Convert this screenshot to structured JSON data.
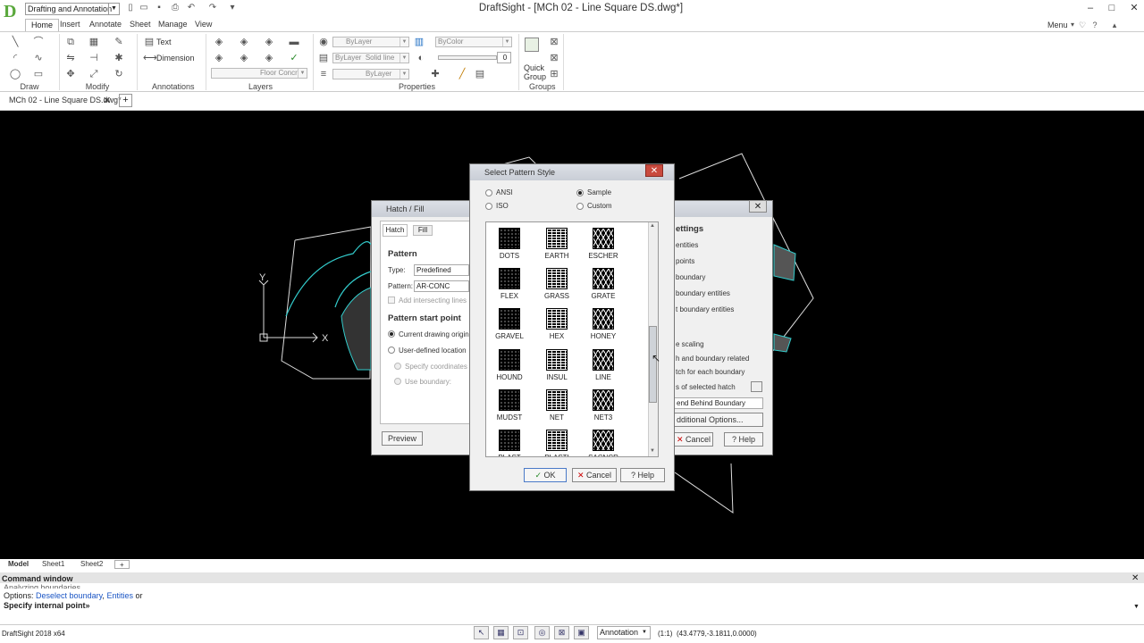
{
  "titlebar": {
    "workspace": "Drafting and Annotation",
    "title": "DraftSight - [MCh 02 - Line Square DS.dwg*]",
    "menu_label": "Menu",
    "min": "–",
    "max": "□",
    "close": "✕"
  },
  "ribbon": {
    "tabs": [
      "Home",
      "Insert",
      "Annotate",
      "Sheet",
      "Manage",
      "View"
    ],
    "groups": {
      "draw": "Draw",
      "modify": "Modify",
      "annotations": "Annotations",
      "layers": "Layers",
      "properties": "Properties",
      "groups": "Groups"
    },
    "text_btn": "Text",
    "dimension_btn": "Dimension",
    "quick_group": [
      "Quick",
      "Group"
    ],
    "layer_combo": "ByLayer",
    "color_combo": "ByColor",
    "linetype_combo": "ByLayer",
    "linetype_name": "Solid line",
    "lineweight_combo": "ByLayer",
    "layer_name": "Floor Concr",
    "transparency": "0"
  },
  "doc_tab": {
    "label": "MCh 02 - Line Square DS.dwg*",
    "close": "✕",
    "add": "+"
  },
  "sheets": {
    "tabs": [
      "Model",
      "Sheet1",
      "Sheet2"
    ],
    "add": "+"
  },
  "command": {
    "title": "Command window",
    "lines": [
      "Analyzing boundaries...",
      "Options: ",
      "Specify internal point»"
    ],
    "opt_deselect": "Deselect boundary",
    "opt_sep": ", ",
    "opt_entities": "Entities",
    "opt_or": " or"
  },
  "status": {
    "version": "DraftSight 2018 x64",
    "annotation": "Annotation",
    "scale": "(1:1)",
    "coords": "(43.4779,-3.1811,0.0000)"
  },
  "hatch_dialog": {
    "title": "Hatch / Fill",
    "tabs": [
      "Hatch",
      "Fill"
    ],
    "pattern_heading": "Pattern",
    "type_label": "Type:",
    "type_value": "Predefined",
    "pattern_label": "Pattern:",
    "pattern_value": "AR-CONC",
    "add_intersecting": "Add intersecting lines",
    "start_heading": "Pattern start point",
    "current_origin": "Current drawing origin",
    "user_location": "User-defined location",
    "specify_coords": "Specify coordinates",
    "use_boundary": "Use boundary:",
    "preview": "Preview",
    "settings_heading": "ettings",
    "right_items": [
      "entities",
      "points",
      "boundary",
      "boundary entities",
      "t boundary entities"
    ],
    "right_items2": [
      "e scaling",
      "h and boundary related",
      "tch for each boundary",
      "s of selected hatch"
    ],
    "draw_order": "end Behind Boundary",
    "additional": "dditional Options...",
    "cancel": "Cancel",
    "help": "Help"
  },
  "pattern_dialog": {
    "title": "Select Pattern Style",
    "radios": {
      "ansi": "ANSI",
      "iso": "ISO",
      "sample": "Sample",
      "custom": "Custom"
    },
    "patterns": [
      "DOTS",
      "EARTH",
      "ESCHER",
      "FLEX",
      "GRASS",
      "GRATE",
      "GRAVEL",
      "HEX",
      "HONEY",
      "HOUND",
      "INSUL",
      "LINE",
      "MUDST",
      "NET",
      "NET3",
      "PLAST",
      "PLASTI",
      "SACNCR"
    ],
    "ok": "OK",
    "cancel": "Cancel",
    "help": "Help"
  }
}
